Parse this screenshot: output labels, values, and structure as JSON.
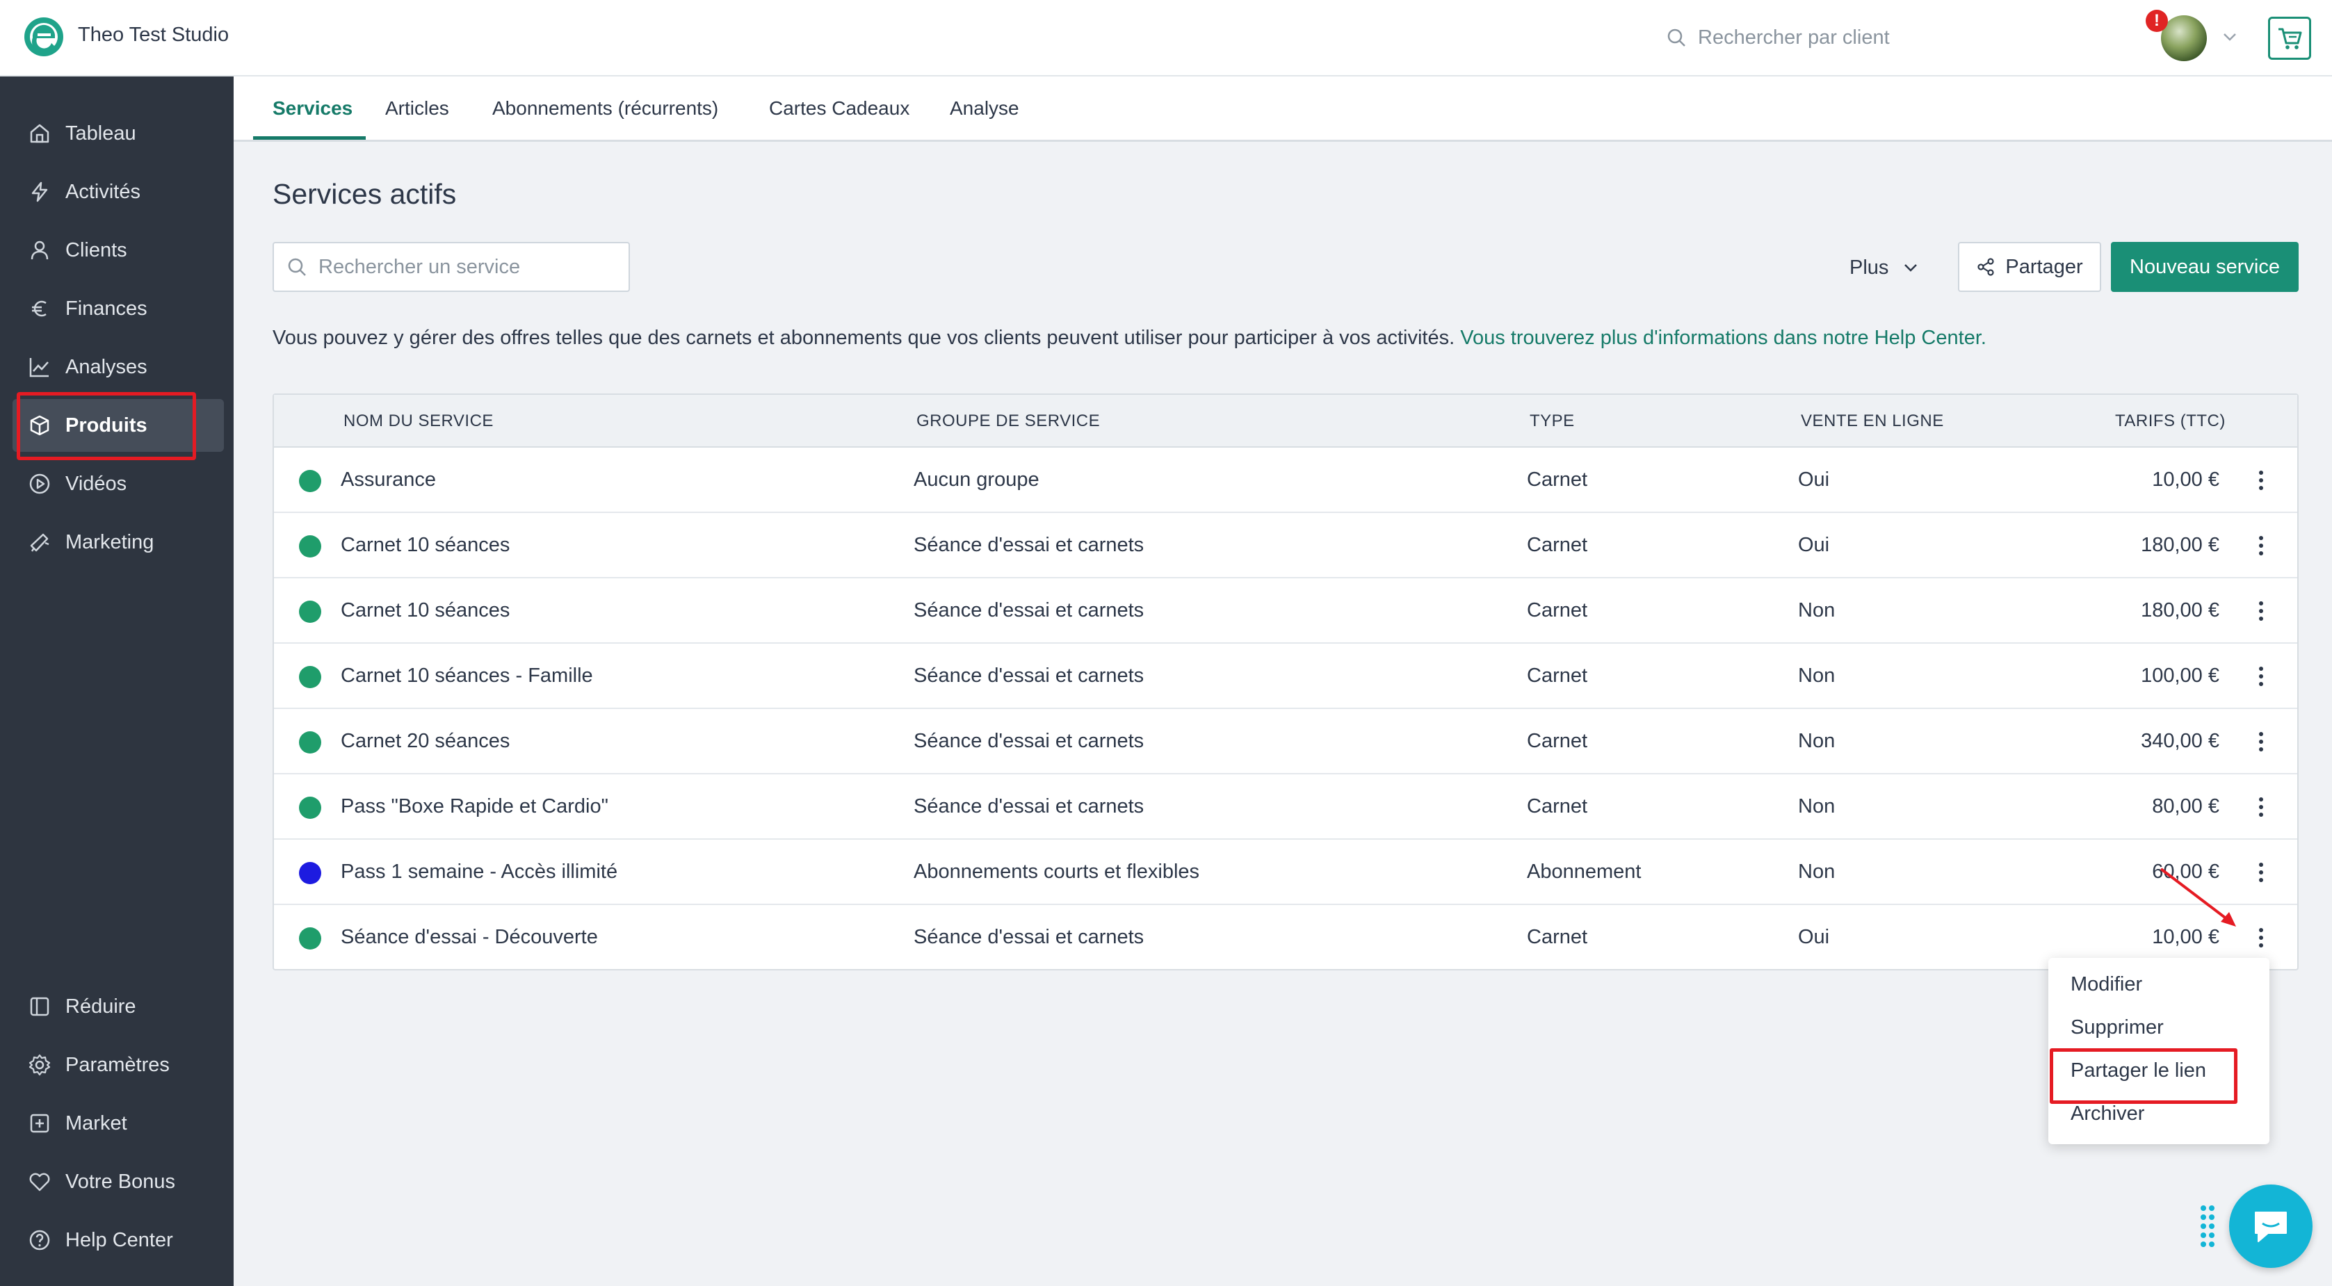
{
  "app": {
    "studio_name": "Theo Test Studio",
    "client_search_placeholder": "Rechercher par client",
    "alert_badge": "!",
    "accent_color": "#1a8f76",
    "sidebar_color": "#2e3540"
  },
  "sidebar": {
    "top_items": [
      {
        "label": "Tableau",
        "icon": "home-icon"
      },
      {
        "label": "Activités",
        "icon": "bolt-icon"
      },
      {
        "label": "Clients",
        "icon": "user-icon"
      },
      {
        "label": "Finances",
        "icon": "euro-icon"
      },
      {
        "label": "Analyses",
        "icon": "chart-icon"
      },
      {
        "label": "Produits",
        "icon": "box-icon",
        "active": true
      },
      {
        "label": "Vidéos",
        "icon": "play-icon"
      },
      {
        "label": "Marketing",
        "icon": "megaphone-icon"
      }
    ],
    "bottom_items": [
      {
        "label": "Réduire",
        "icon": "collapse-icon"
      },
      {
        "label": "Paramètres",
        "icon": "gear-icon"
      },
      {
        "label": "Market",
        "icon": "plus-square-icon"
      },
      {
        "label": "Votre Bonus",
        "icon": "heart-icon"
      },
      {
        "label": "Help Center",
        "icon": "help-icon"
      }
    ]
  },
  "tabs": [
    "Services",
    "Articles",
    "Abonnements (récurrents)",
    "Cartes Cadeaux",
    "Analyse"
  ],
  "main": {
    "title": "Services actifs",
    "search_placeholder": "Rechercher un service",
    "plus_label": "Plus",
    "share_label": "Partager",
    "new_service_label": "Nouveau service",
    "info_text": "Vous pouvez y gérer des offres telles que des carnets et abonnements que vos clients peuvent utiliser pour participer à vos activités.",
    "info_link": "Vous trouverez plus d'informations dans notre Help Center."
  },
  "table": {
    "headers": [
      "NOM DU SERVICE",
      "GROUPE DE SERVICE",
      "TYPE",
      "VENTE EN LIGNE",
      "TARIFS (TTC)"
    ],
    "rows": [
      {
        "name": "Assurance",
        "group": "Aucun groupe",
        "type": "Carnet",
        "online": "Oui",
        "price": "10,00 €",
        "color": "#1f9d6b"
      },
      {
        "name": "Carnet 10 séances",
        "group": "Séance d'essai et carnets",
        "type": "Carnet",
        "online": "Oui",
        "price": "180,00 €",
        "color": "#1f9d6b"
      },
      {
        "name": "Carnet 10 séances",
        "group": "Séance d'essai et carnets",
        "type": "Carnet",
        "online": "Non",
        "price": "180,00 €",
        "color": "#1f9d6b"
      },
      {
        "name": "Carnet 10 séances - Famille",
        "group": "Séance d'essai et carnets",
        "type": "Carnet",
        "online": "Non",
        "price": "100,00 €",
        "color": "#1f9d6b"
      },
      {
        "name": "Carnet 20 séances",
        "group": "Séance d'essai et carnets",
        "type": "Carnet",
        "online": "Non",
        "price": "340,00 €",
        "color": "#1f9d6b"
      },
      {
        "name": "Pass \"Boxe Rapide et Cardio\"",
        "group": "Séance d'essai et carnets",
        "type": "Carnet",
        "online": "Non",
        "price": "80,00 €",
        "color": "#1f9d6b"
      },
      {
        "name": "Pass 1 semaine - Accès illimité",
        "group": "Abonnements courts et flexibles",
        "type": "Abonnement",
        "online": "Non",
        "price": "60,00 €",
        "color": "#1d1be0"
      },
      {
        "name": "Séance d'essai - Découverte",
        "group": "Séance d'essai et carnets",
        "type": "Carnet",
        "online": "Oui",
        "price": "10,00 €",
        "color": "#1f9d6b"
      }
    ]
  },
  "row_menu": {
    "items": [
      "Modifier",
      "Supprimer",
      "Partager le lien",
      "Archiver"
    ]
  },
  "annotation_color": "#e51b23"
}
